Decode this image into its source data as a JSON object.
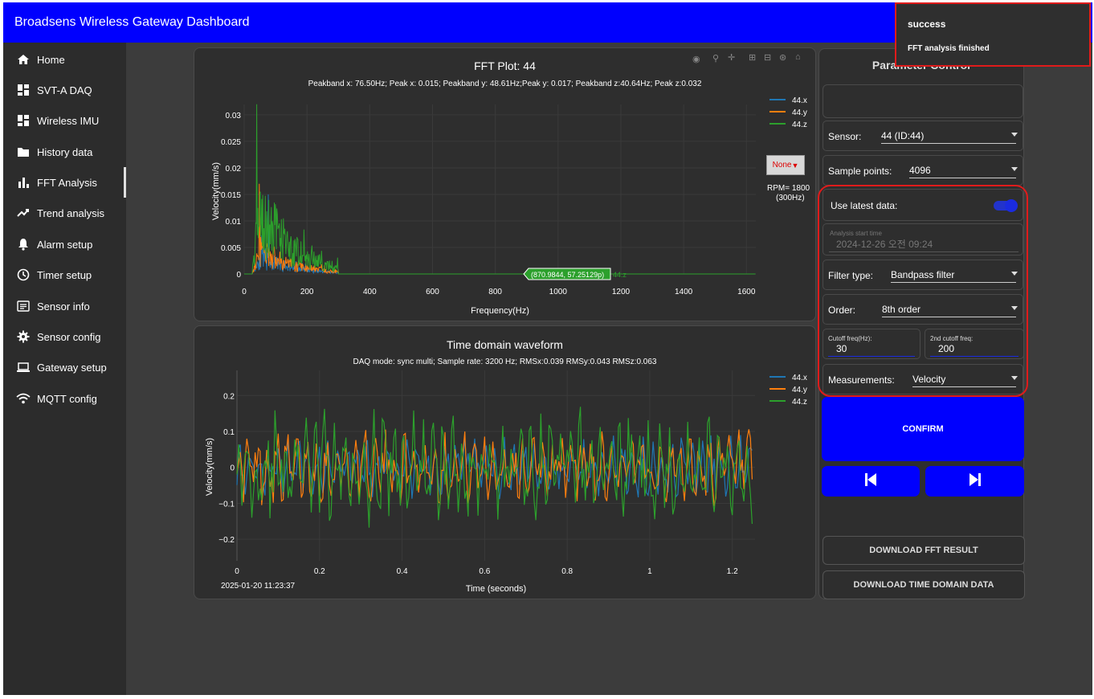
{
  "app": {
    "title": "Broadsens Wireless Gateway Dashboard"
  },
  "sidebar": {
    "items": [
      {
        "label": "Home",
        "icon": "home-icon"
      },
      {
        "label": "SVT-A DAQ",
        "icon": "dashboard-icon"
      },
      {
        "label": "Wireless IMU",
        "icon": "dashboard-icon"
      },
      {
        "label": "History data",
        "icon": "folder-icon"
      },
      {
        "label": "FFT Analysis",
        "icon": "bar-chart-icon"
      },
      {
        "label": "Trend analysis",
        "icon": "trend-icon"
      },
      {
        "label": "Alarm setup",
        "icon": "bell-icon"
      },
      {
        "label": "Timer setup",
        "icon": "clock-icon"
      },
      {
        "label": "Sensor info",
        "icon": "list-icon"
      },
      {
        "label": "Sensor config",
        "icon": "gear-icon"
      },
      {
        "label": "Gateway setup",
        "icon": "laptop-icon"
      },
      {
        "label": "MQTT config",
        "icon": "wifi-icon"
      }
    ],
    "active": "FFT Analysis"
  },
  "fft": {
    "title": "FFT Plot: 44",
    "peak_info": "Peakband x: 76.50Hz; Peak x: 0.015; Peakband y: 48.61Hz;Peak y: 0.017; Peakband z:40.64Hz; Peak z:0.032",
    "xlabel": "Frequency(Hz)",
    "ylabel": "Velocity(mm/s)",
    "xticks": [
      "0",
      "200",
      "400",
      "600",
      "800",
      "1000",
      "1200",
      "1400",
      "1600"
    ],
    "yticks": [
      "0",
      "0.005",
      "0.01",
      "0.015",
      "0.02",
      "0.025",
      "0.03"
    ],
    "legend": [
      "44.x",
      "44.y",
      "44.z"
    ],
    "hover_label": "(870.9844, 57.25129p)",
    "hover_series": "44.z",
    "dropdown": "None",
    "rpm_line1": "RPM= 1800",
    "rpm_line2": "(300Hz)"
  },
  "wave": {
    "title": "Time domain waveform",
    "info": "DAQ mode: sync multi; Sample rate: 3200 Hz; RMSx:0.039 RMSy:0.043 RMSz:0.063",
    "xlabel": "Time (seconds)",
    "ylabel": "Velocity(mm/s)",
    "xticks": [
      "0",
      "0.2",
      "0.4",
      "0.6",
      "0.8",
      "1",
      "1.2"
    ],
    "yticks": [
      "0.2",
      "0.1",
      "0",
      "−0.1",
      "−0.2"
    ],
    "legend": [
      "44.x",
      "44.y",
      "44.z"
    ],
    "timestamp": "2025-01-20 11:23:37"
  },
  "colors": {
    "x": "#1f77b4",
    "y": "#ff7f0e",
    "z": "#2ca02c",
    "accent": "#0000fe",
    "highlight": "#e01b1b"
  },
  "params": {
    "title": "Parameter Control",
    "sensor_label": "Sensor:",
    "sensor_value": "44 (ID:44)",
    "sample_label": "Sample points:",
    "sample_value": "4096",
    "latest_label": "Use latest data:",
    "latest_on": true,
    "start_label": "Analysis start time",
    "start_value": "2024-12-26 오전 09:24",
    "filter_label": "Filter type:",
    "filter_value": "Bandpass filter",
    "order_label": "Order:",
    "order_value": "8th order",
    "cutoff_label": "Cutoff freq(Hz):",
    "cutoff_value": "30",
    "cutoff2_label": "2nd cutoff freq:",
    "cutoff2_value": "200",
    "meas_label": "Measurements:",
    "meas_value": "Velocity",
    "confirm": "CONFIRM",
    "download_fft": "DOWNLOAD FFT RESULT",
    "download_time": "DOWNLOAD TIME DOMAIN DATA"
  },
  "toast": {
    "title": "success",
    "message": "FFT analysis finished"
  }
}
